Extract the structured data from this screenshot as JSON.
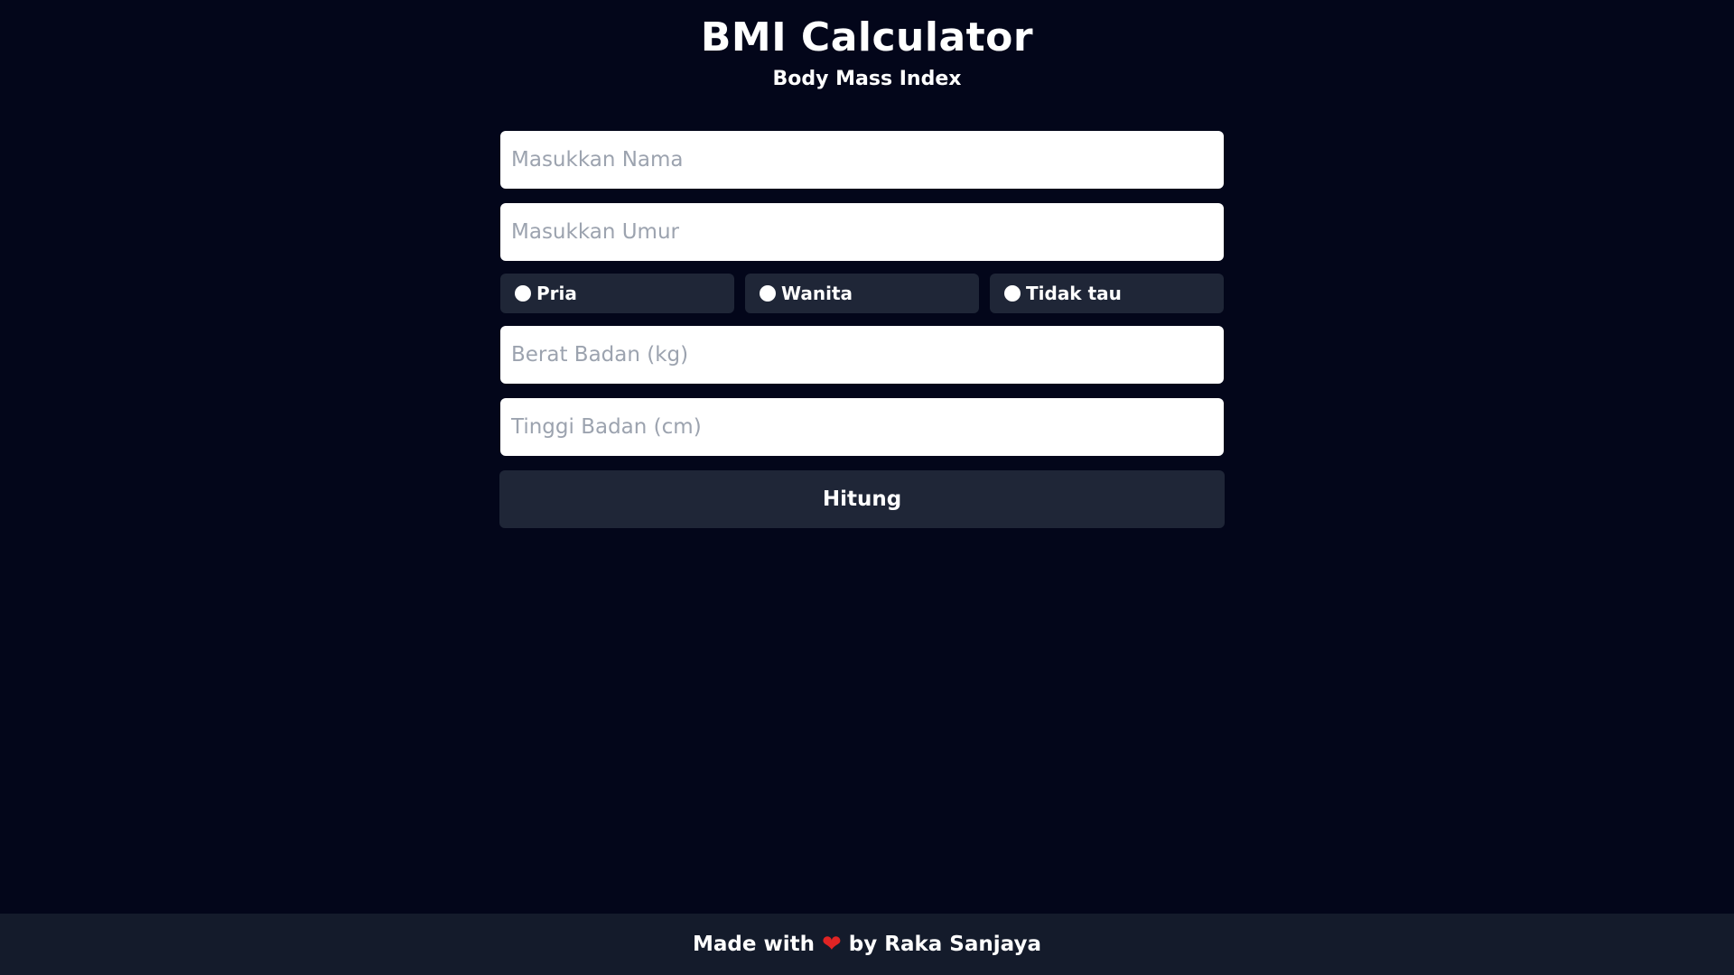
{
  "header": {
    "title": "BMI Calculator",
    "subtitle": "Body Mass Index"
  },
  "form": {
    "name_placeholder": "Masukkan Nama",
    "age_placeholder": "Masukkan Umur",
    "gender_options": [
      {
        "label": "Pria"
      },
      {
        "label": "Wanita"
      },
      {
        "label": "Tidak tau"
      }
    ],
    "weight_placeholder": "Berat Badan (kg)",
    "height_placeholder": "Tinggi Badan (cm)",
    "submit_label": "Hitung"
  },
  "footer": {
    "prefix": "Made with",
    "icon": "heart-icon",
    "suffix": "by Raka Sanjaya"
  },
  "colors": {
    "background": "#03061a",
    "panel": "#1f2637",
    "footer_background": "#141b2b",
    "heart": "#e02424"
  }
}
